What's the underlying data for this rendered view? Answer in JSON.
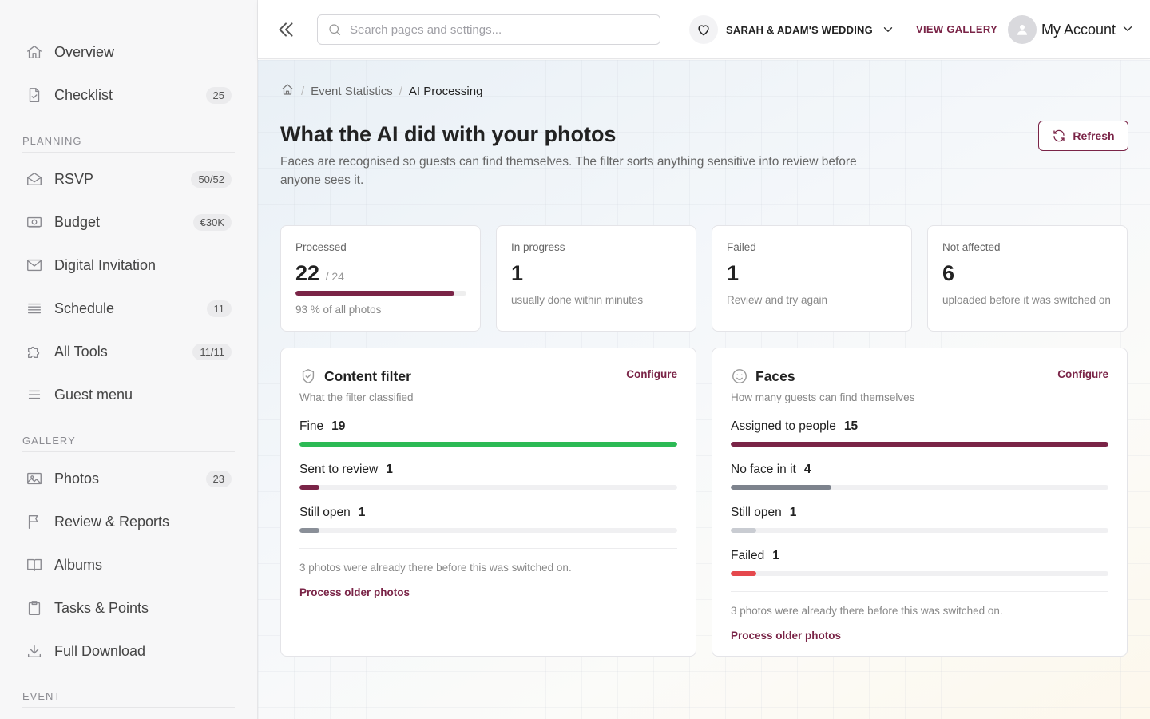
{
  "sidebar": {
    "items": [
      {
        "label": "Overview",
        "badge": "",
        "icon": "home-icon"
      },
      {
        "label": "Checklist",
        "badge": "25",
        "icon": "checklist-icon"
      },
      {
        "label": "RSVP",
        "badge": "50/52",
        "icon": "envelope-open-icon"
      },
      {
        "label": "Budget",
        "badge": "€30K",
        "icon": "money-icon"
      },
      {
        "label": "Digital Invitation",
        "badge": "",
        "icon": "mail-icon"
      },
      {
        "label": "Schedule",
        "badge": "11",
        "icon": "list-icon"
      },
      {
        "label": "All Tools",
        "badge": "11/11",
        "icon": "puzzle-icon"
      },
      {
        "label": "Guest menu",
        "badge": "",
        "icon": "menu-icon"
      },
      {
        "label": "Photos",
        "badge": "23",
        "icon": "image-icon"
      },
      {
        "label": "Review & Reports",
        "badge": "",
        "icon": "flag-icon"
      },
      {
        "label": "Albums",
        "badge": "",
        "icon": "book-icon"
      },
      {
        "label": "Tasks & Points",
        "badge": "",
        "icon": "clipboard-icon"
      },
      {
        "label": "Full Download",
        "badge": "",
        "icon": "download-icon"
      }
    ],
    "sections": {
      "planning": "PLANNING",
      "gallery": "GALLERY",
      "event": "EVENT"
    }
  },
  "header": {
    "search_placeholder": "Search pages and settings...",
    "event_name": "SARAH & ADAM'S WEDDING",
    "view_gallery": "VIEW GALLERY",
    "account_label": "My Account"
  },
  "breadcrumb": {
    "parent": "Event Statistics",
    "current": "AI Processing"
  },
  "page": {
    "title": "What the AI did with your photos",
    "description": "Faces are recognised so guests can find themselves. The filter sorts anything sensitive into review before anyone sees it.",
    "refresh_label": "Refresh"
  },
  "stats": {
    "processed": {
      "label": "Processed",
      "value": "22",
      "total": "/ 24",
      "sub": "93 % of all photos",
      "fraction": 0.93
    },
    "in_progress": {
      "label": "In progress",
      "value": "1",
      "sub": "usually done within minutes"
    },
    "failed": {
      "label": "Failed",
      "value": "1",
      "sub": "Review and try again"
    },
    "not_affected": {
      "label": "Not affected",
      "value": "6",
      "sub": "uploaded before it was switched on"
    }
  },
  "content_filter": {
    "title": "Content filter",
    "subtitle": "What the filter classified",
    "configure": "Configure",
    "rows": [
      {
        "label": "Fine",
        "value": "19",
        "fraction": 1.0,
        "color": "#2cba55"
      },
      {
        "label": "Sent to review",
        "value": "1",
        "fraction": 0.053,
        "color": "#7a2447"
      },
      {
        "label": "Still open",
        "value": "1",
        "fraction": 0.053,
        "color": "#8a8f98"
      }
    ],
    "note": "3 photos were already there before this was switched on.",
    "process_link": "Process older photos"
  },
  "faces": {
    "title": "Faces",
    "subtitle": "How many guests can find themselves",
    "configure": "Configure",
    "rows": [
      {
        "label": "Assigned to people",
        "value": "15",
        "fraction": 1.0,
        "color": "#7a2447"
      },
      {
        "label": "No face in it",
        "value": "4",
        "fraction": 0.267,
        "color": "#7d838d"
      },
      {
        "label": "Still open",
        "value": "1",
        "fraction": 0.067,
        "color": "#c9ccd2"
      },
      {
        "label": "Failed",
        "value": "1",
        "fraction": 0.067,
        "color": "#e5484d"
      }
    ],
    "note": "3 photos were already there before this was switched on.",
    "process_link": "Process older photos"
  }
}
